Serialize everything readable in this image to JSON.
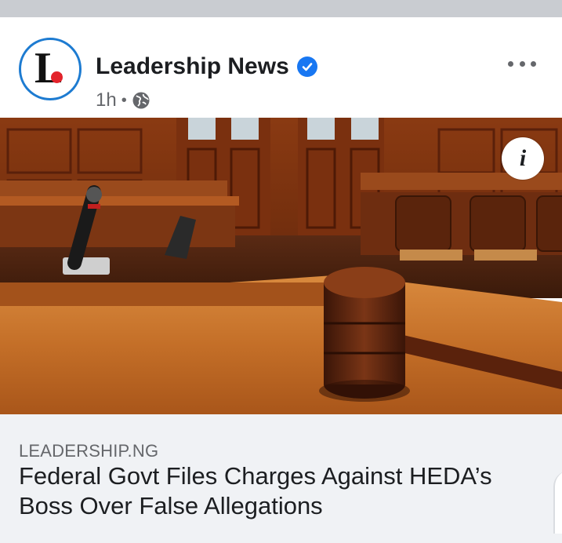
{
  "post": {
    "page_name": "Leadership News",
    "avatar_letter": "L",
    "time": "1h",
    "separator": "•",
    "verified": true,
    "privacy_icon": "globe-icon",
    "more_icon": "more-options-icon",
    "info_icon_label": "i",
    "link": {
      "domain": "LEADERSHIP.NG",
      "title": "Federal Govt Files Charges Against HEDA’s Boss Over False Allegations"
    },
    "image_description_icon": "courtroom-gavel-image"
  },
  "colors": {
    "brand_blue": "#1877f2",
    "avatar_ring": "#1d7bd1",
    "avatar_dot": "#e3232b",
    "text_primary": "#1c1e21",
    "text_secondary": "#65676b",
    "link_box_bg": "#f0f2f5"
  }
}
